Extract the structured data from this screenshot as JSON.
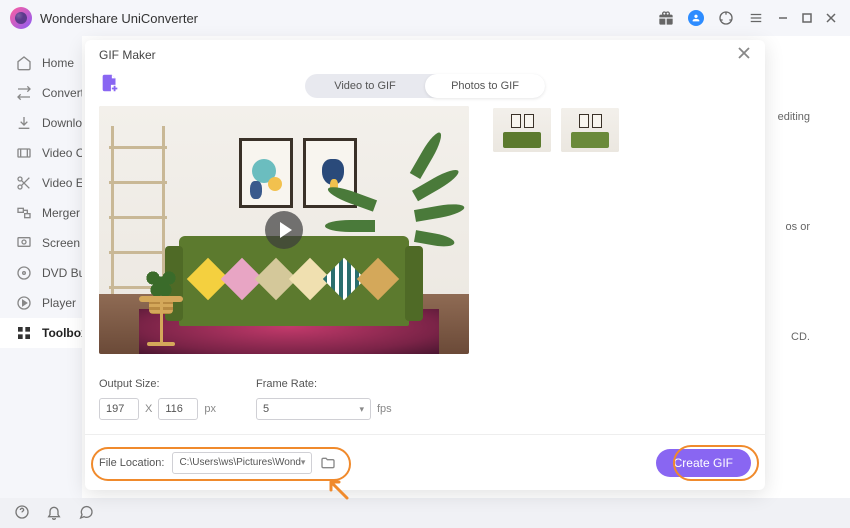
{
  "app": {
    "title": "Wondershare UniConverter"
  },
  "sidebar": {
    "items": [
      {
        "label": "Home"
      },
      {
        "label": "Converter"
      },
      {
        "label": "Downloader"
      },
      {
        "label": "Video Compressor"
      },
      {
        "label": "Video Editor"
      },
      {
        "label": "Merger"
      },
      {
        "label": "Screen Recorder"
      },
      {
        "label": "DVD Burner"
      },
      {
        "label": "Player"
      },
      {
        "label": "Toolbox"
      }
    ]
  },
  "background": {
    "snippet1": "editing",
    "snippet2": "os or",
    "snippet3": "CD."
  },
  "modal": {
    "title": "GIF Maker",
    "tabs": {
      "video": "Video to GIF",
      "photos": "Photos to GIF"
    },
    "output_size_label": "Output Size:",
    "width": "197",
    "height": "116",
    "x": "X",
    "px": "px",
    "frame_rate_label": "Frame Rate:",
    "frame_rate": "5",
    "fps": "fps",
    "file_location_label": "File Location:",
    "file_location_path": "C:\\Users\\ws\\Pictures\\Wondersh",
    "create_label": "Create GIF"
  }
}
